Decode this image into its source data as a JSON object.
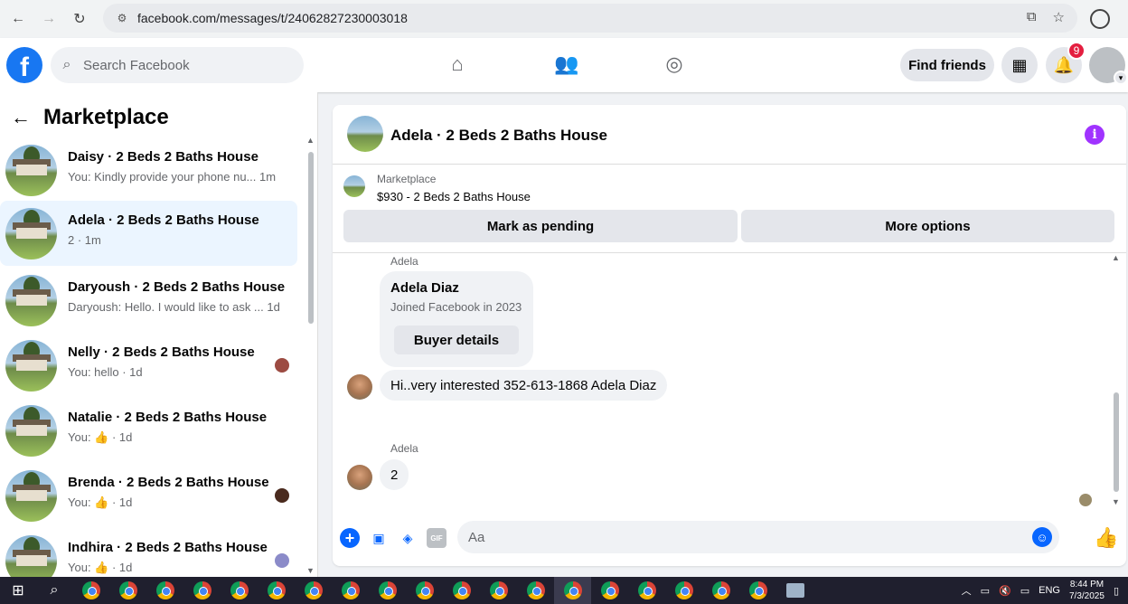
{
  "browser": {
    "url": "facebook.com/messages/t/24062827230003018"
  },
  "fb_header": {
    "search_placeholder": "Search Facebook",
    "find_friends_label": "Find friends",
    "notifications_count": "9"
  },
  "sidebar": {
    "title": "Marketplace",
    "conversations": [
      {
        "name": "Daisy · 2 Beds 2 Baths House",
        "preview": "You: Kindly provide your phone nu...  1m"
      },
      {
        "name": "Adela · 2 Beds 2 Baths House",
        "preview": "2 · 1m"
      },
      {
        "name": "Daryoush · 2 Beds 2 Baths House",
        "preview": "Daryoush: Hello. I would like to ask ...  1d"
      },
      {
        "name": "Nelly · 2 Beds 2 Baths House",
        "preview": "You: hello · 1d"
      },
      {
        "name": "Natalie · 2 Beds 2 Baths House",
        "preview": "You: 👍 · 1d"
      },
      {
        "name": "Brenda · 2 Beds 2 Baths House",
        "preview": "You: 👍 · 1d"
      },
      {
        "name": "Indhira · 2 Beds 2 Baths House",
        "preview": "You: 👍 · 1d"
      }
    ]
  },
  "chat": {
    "title": "Adela · 2 Beds 2 Baths House",
    "marketplace_label": "Marketplace",
    "listing": "$930 - 2 Beds 2 Baths House",
    "mark_pending_label": "Mark as pending",
    "more_options_label": "More options",
    "sender_label_1": "Adela",
    "buyer_name": "Adela Diaz",
    "buyer_joined": "Joined Facebook in 2023",
    "buyer_details_label": "Buyer details",
    "message_1": "Hi..very interested 352-613-1868 Adela Diaz",
    "sender_label_2": "Adela",
    "message_2": "2",
    "composer_placeholder": "Aa"
  },
  "taskbar": {
    "language": "ENG",
    "time": "8:44 PM",
    "date": "7/3/2025"
  },
  "colors": {
    "facebook_blue": "#1877f2",
    "messenger_blue": "#0866ff",
    "badge_red": "#e41e3f",
    "info_purple": "#a033ff"
  }
}
